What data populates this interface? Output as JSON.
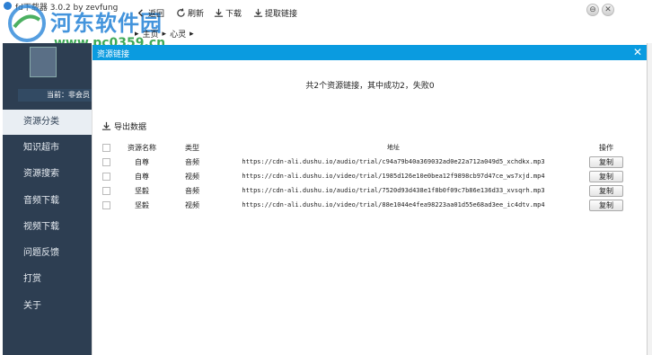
{
  "window": {
    "title": "fd下载器 3.0.2 by zevfung"
  },
  "watermark": {
    "name": "河东软件园",
    "url": "www.pc0359.cn"
  },
  "toolbar": {
    "back": "返回",
    "refresh": "刷新",
    "download": "下载",
    "extract": "提取链接"
  },
  "window_controls": {
    "minimize": "⊖",
    "close": "✕"
  },
  "breadcrumb": {
    "home": "主页",
    "current": "心灵"
  },
  "sidebar": {
    "member_label": "当前：非会员",
    "items": [
      {
        "label": "资源分类"
      },
      {
        "label": "知识超市"
      },
      {
        "label": "资源搜索"
      },
      {
        "label": "音频下载"
      },
      {
        "label": "视频下载"
      },
      {
        "label": "问题反馈"
      },
      {
        "label": "打赏"
      },
      {
        "label": "关于"
      }
    ]
  },
  "dialog": {
    "title": "资源链接",
    "close": "✕",
    "summary": "共2个资源链接，其中成功2，失败0",
    "export_label": "导出数据"
  },
  "table": {
    "headers": {
      "name": "资源名称",
      "type": "类型",
      "address": "地址",
      "op": "操作"
    },
    "copy_label": "复制",
    "rows": [
      {
        "name": "自尊",
        "type": "音频",
        "address": "https://cdn-ali.dushu.io/audio/trial/c94a79b40a369032ad0e22a712a049d5_xchdkx.mp3"
      },
      {
        "name": "自尊",
        "type": "视频",
        "address": "https://cdn-ali.dushu.io/video/trial/1985d126e10e0bea12f9898cb97d47ce_ws7xjd.mp4"
      },
      {
        "name": "坚毅",
        "type": "音频",
        "address": "https://cdn-ali.dushu.io/audio/trial/7520d93d438e1f8b0f09c7b86e136d33_xvsqrh.mp3"
      },
      {
        "name": "坚毅",
        "type": "视频",
        "address": "https://cdn-ali.dushu.io/video/trial/88e1044e4fea98223aa01d55e68ad3ee_ic4dtv.mp4"
      }
    ]
  }
}
